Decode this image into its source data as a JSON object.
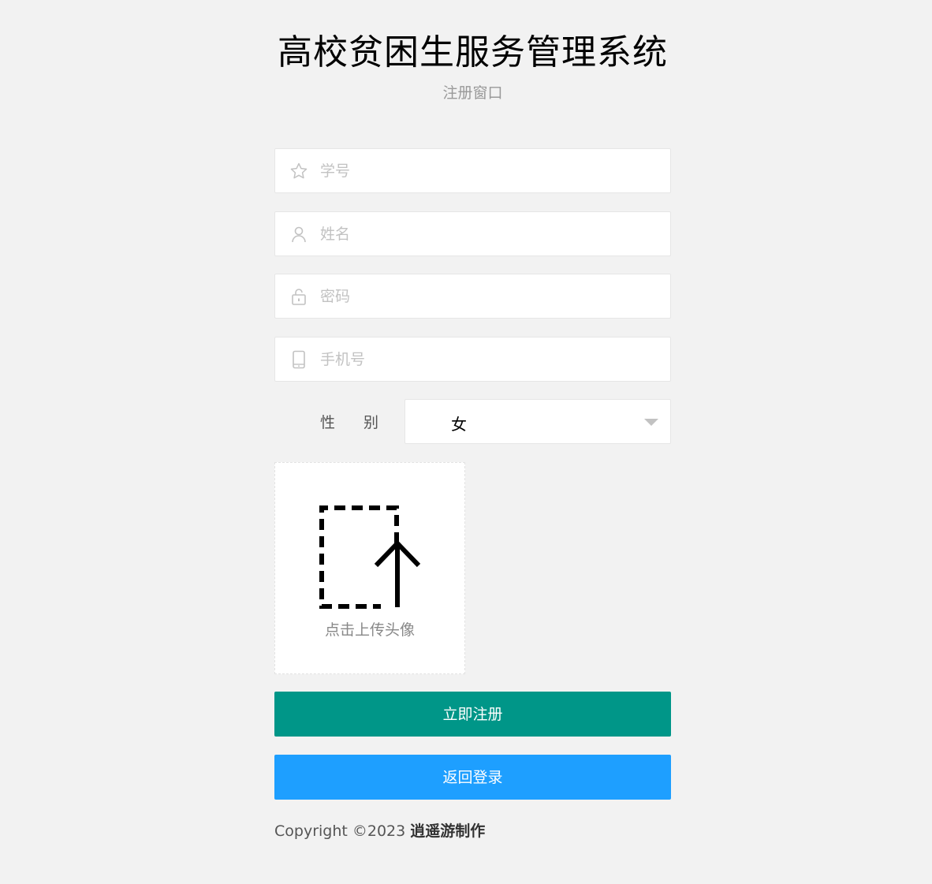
{
  "header": {
    "title": "高校贫困生服务管理系统",
    "subtitle": "注册窗口"
  },
  "form": {
    "student_id": {
      "placeholder": "学号",
      "value": "",
      "icon": "star-icon"
    },
    "name": {
      "placeholder": "姓名",
      "value": "",
      "icon": "user-icon"
    },
    "password": {
      "placeholder": "密码",
      "value": "",
      "icon": "lock-icon"
    },
    "phone": {
      "placeholder": "手机号",
      "value": "",
      "icon": "phone-icon"
    },
    "gender": {
      "label": "性别",
      "selected": "女"
    },
    "avatar_upload": {
      "label": "点击上传头像",
      "icon": "upload-icon"
    }
  },
  "buttons": {
    "register": "立即注册",
    "back_to_login": "返回登录"
  },
  "footer": {
    "copyright": "Copyright ©2023 ",
    "author": "逍遥游制作"
  },
  "colors": {
    "background": "#f2f2f2",
    "register_button": "#009688",
    "login_button": "#1e9fff"
  }
}
